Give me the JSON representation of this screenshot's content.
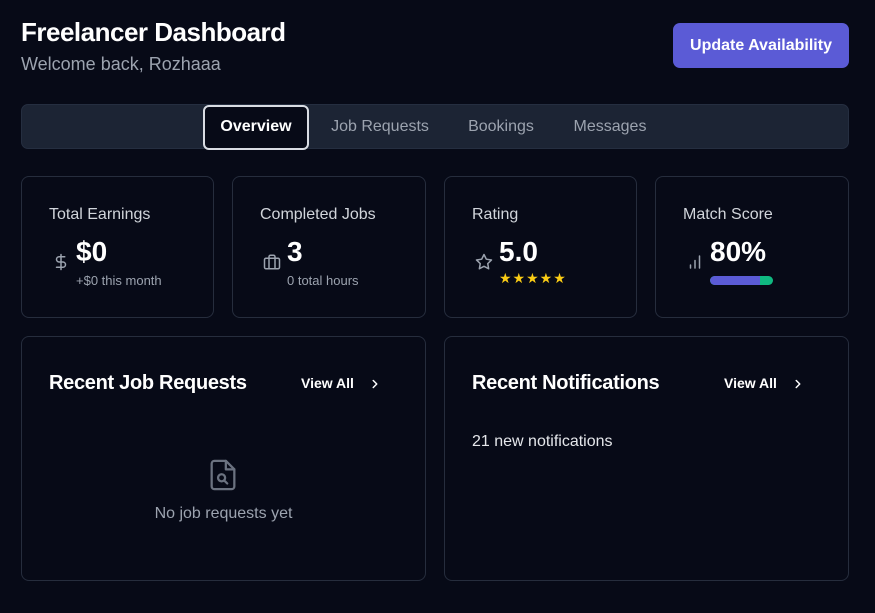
{
  "header": {
    "title": "Freelancer Dashboard",
    "subtitle": "Welcome back, Rozhaaa",
    "action_label": "Update Availability"
  },
  "tabs": [
    {
      "label": "Overview",
      "active": true
    },
    {
      "label": "Job Requests",
      "active": false
    },
    {
      "label": "Bookings",
      "active": false
    },
    {
      "label": "Messages",
      "active": false
    }
  ],
  "stats": {
    "earnings": {
      "label": "Total Earnings",
      "value": "$0",
      "sub": "+$0 this month",
      "icon": "dollar-icon"
    },
    "jobs": {
      "label": "Completed Jobs",
      "value": "3",
      "sub": "0 total hours",
      "icon": "briefcase-icon"
    },
    "rating": {
      "label": "Rating",
      "value": "5.0",
      "stars": "★★★★★",
      "star_count": 5,
      "icon": "star-icon"
    },
    "match": {
      "label": "Match Score",
      "value": "80%",
      "progress": 0.8,
      "icon": "signal-icon"
    }
  },
  "job_requests": {
    "title": "Recent Job Requests",
    "view_all": "View All",
    "empty_text": "No job requests yet",
    "empty_icon": "file-search-icon"
  },
  "notifications": {
    "title": "Recent Notifications",
    "view_all": "View All",
    "summary": "21 new notifications"
  },
  "colors": {
    "background": "#070a17",
    "accent": "#5b5bd6",
    "progress_track": "#10b981",
    "star": "#facc15"
  }
}
